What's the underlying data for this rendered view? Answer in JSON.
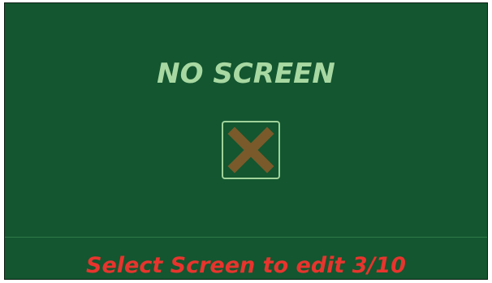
{
  "screen": {
    "title": "NO SCREEN",
    "icon": "close-x-icon",
    "footer_text": "Select Screen to edit 3/10"
  },
  "colors": {
    "background": "#135630",
    "title": "#a8d8a2",
    "icon_border": "#9fd29a",
    "icon_x": "#7a5a2a",
    "footer_text": "#e8342d",
    "divider": "#2f7a48"
  }
}
